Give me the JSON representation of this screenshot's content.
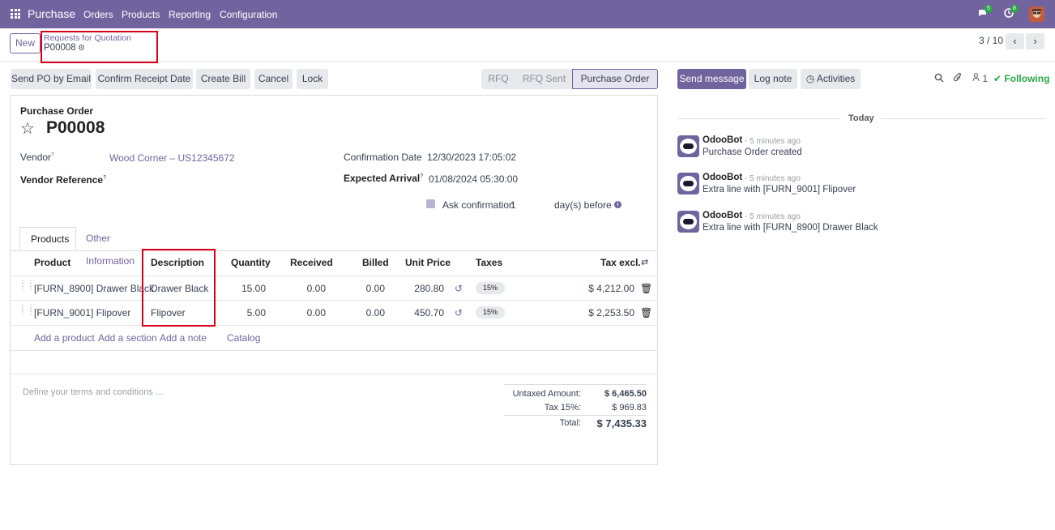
{
  "topbar": {
    "app_name": "Purchase",
    "menu": [
      "Orders",
      "Products",
      "Reporting",
      "Configuration"
    ],
    "messages_count": "5",
    "activities_count": "8"
  },
  "control_panel": {
    "new_label": "New",
    "breadcrumb_parent": "Requests for Quotation",
    "breadcrumb_current": "P00008",
    "pager": "3 / 10"
  },
  "actions": {
    "send_po": "Send PO by Email",
    "confirm_receipt": "Confirm Receipt Date",
    "create_bill": "Create Bill",
    "cancel": "Cancel",
    "lock": "Lock"
  },
  "statusbar": [
    "RFQ",
    "RFQ Sent",
    "Purchase Order"
  ],
  "form": {
    "doc_type": "Purchase Order",
    "name": "P00008",
    "vendor_label": "Vendor",
    "vendor_value": "Wood Corner – US12345672",
    "vendor_ref_label": "Vendor Reference",
    "confirmation_date_label": "Confirmation Date",
    "confirmation_date_value": "12/30/2023 17:05:02",
    "expected_arrival_label": "Expected Arrival",
    "expected_arrival_value": "01/08/2024 05:30:00",
    "ask_confirmation_label": "Ask confirmation",
    "ask_confirmation_days": "1",
    "ask_confirmation_suffix": "day(s) before"
  },
  "tabs": [
    "Products",
    "Other Information"
  ],
  "table": {
    "headers": [
      "Product",
      "Description",
      "Quantity",
      "Received",
      "Billed",
      "Unit Price",
      "Taxes",
      "Tax excl."
    ],
    "rows": [
      {
        "product": "[FURN_8900] Drawer Black",
        "description": "Drawer Black",
        "quantity": "15.00",
        "received": "0.00",
        "billed": "0.00",
        "unit_price": "280.80",
        "tax": "15%",
        "subtotal": "$ 4,212.00"
      },
      {
        "product": "[FURN_9001] Flipover",
        "description": "Flipover",
        "quantity": "5.00",
        "received": "0.00",
        "billed": "0.00",
        "unit_price": "450.70",
        "tax": "15%",
        "subtotal": "$ 2,253.50"
      }
    ],
    "add_links": [
      "Add a product",
      "Add a section",
      "Add a note",
      "Catalog"
    ]
  },
  "terms_placeholder": "Define your terms and conditions ...",
  "totals": {
    "untaxed_label": "Untaxed Amount:",
    "untaxed_value": "$ 6,465.50",
    "tax_label": "Tax 15%:",
    "tax_value": "$ 969.83",
    "total_label": "Total:",
    "total_value": "$ 7,435.33"
  },
  "chatter": {
    "send_message": "Send message",
    "log_note": "Log note",
    "activities": "Activities",
    "followers_count": "1",
    "following": "Following",
    "date_separator": "Today",
    "messages": [
      {
        "author": "OdooBot",
        "time": "- 5 minutes ago",
        "body": "Purchase Order created"
      },
      {
        "author": "OdooBot",
        "time": "- 5 minutes ago",
        "body": "Extra line with [FURN_9001] Flipover"
      },
      {
        "author": "OdooBot",
        "time": "- 5 minutes ago",
        "body": "Extra line with [FURN_8900] Drawer Black"
      }
    ]
  },
  "colors": {
    "brand": "#71639e",
    "highlight": "#d9001b",
    "following": "#28a745"
  }
}
